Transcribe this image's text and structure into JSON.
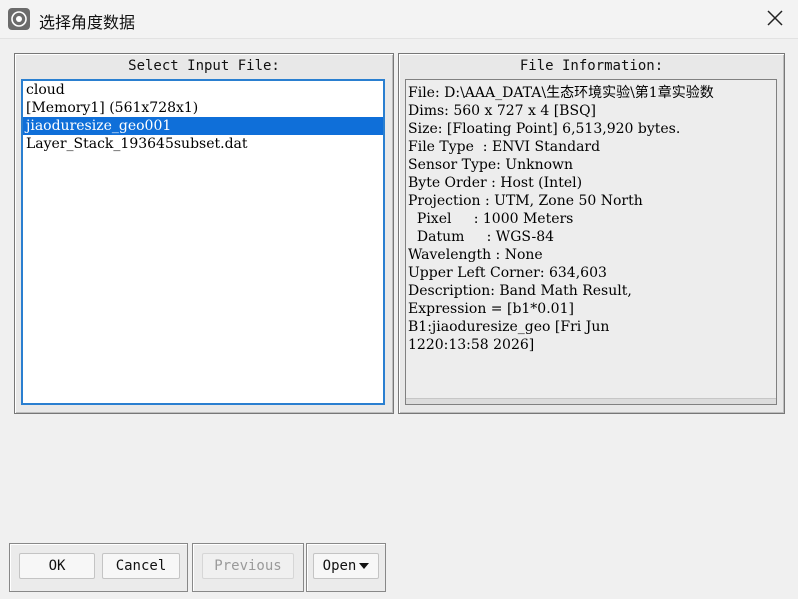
{
  "window": {
    "title": "选择角度数据"
  },
  "left_panel": {
    "header": "Select Input File:",
    "items": [
      {
        "label": "cloud",
        "selected": false
      },
      {
        "label": "[Memory1] (561x728x1)",
        "selected": false
      },
      {
        "label": "jiaoduresize_geo001",
        "selected": true
      },
      {
        "label": "Layer_Stack_193645subset.dat",
        "selected": false
      }
    ]
  },
  "right_panel": {
    "header": "File Information:",
    "lines": [
      "File: D:\\AAA_DATA\\生态环境实验\\第1章实验数",
      "Dims: 560 x 727 x 4 [BSQ]",
      "Size: [Floating Point] 6,513,920 bytes.",
      "File Type  : ENVI Standard",
      "Sensor Type: Unknown",
      "Byte Order : Host (Intel)",
      "Projection : UTM, Zone 50 North",
      "  Pixel     : 1000 Meters",
      "  Datum     : WGS-84",
      "Wavelength : None",
      "Upper Left Corner: 634,603",
      "Description: Band Math Result,",
      "Expression = [b1*0.01]",
      "B1:jiaoduresize_geo [Fri Jun",
      "1220:13:58 2026]"
    ]
  },
  "buttons": {
    "ok": "OK",
    "cancel": "Cancel",
    "previous": "Previous",
    "open": "Open"
  }
}
